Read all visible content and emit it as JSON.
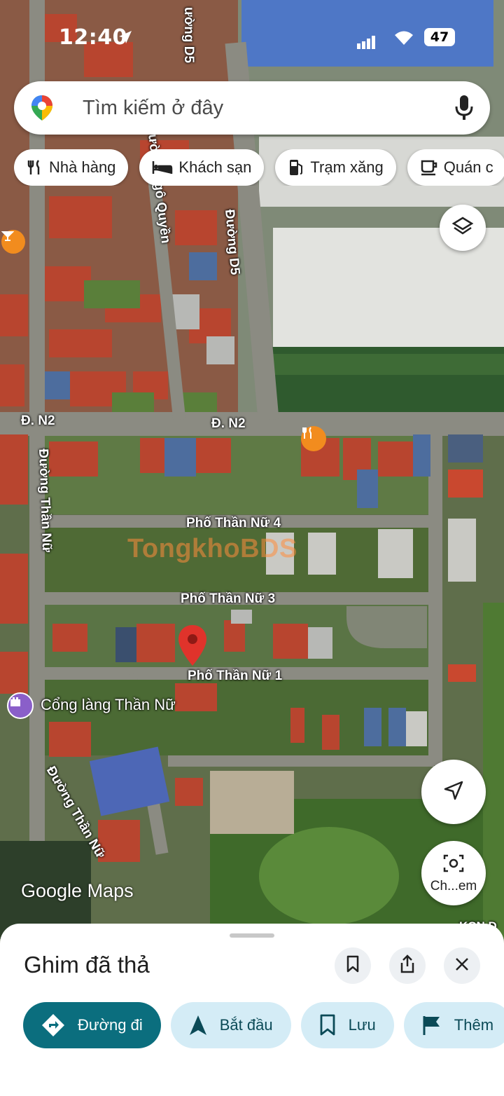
{
  "status": {
    "time": "12:40",
    "battery": "47"
  },
  "search": {
    "placeholder": "Tìm kiếm ở đây"
  },
  "chips": [
    {
      "label": "Nhà hàng",
      "icon": "fork-knife-icon"
    },
    {
      "label": "Khách sạn",
      "icon": "bed-icon"
    },
    {
      "label": "Trạm xăng",
      "icon": "gas-pump-icon"
    },
    {
      "label": "Quán c",
      "icon": "coffee-cup-icon"
    }
  ],
  "map": {
    "streets": {
      "d5_top": "ường D5",
      "ngo_quyen": "ường Ngô Quyền",
      "d5": "Đường D5",
      "n2_left": "Đ. N2",
      "n2_mid": "Đ. N2",
      "than_nu_left": "Đường Thần Nữ",
      "pho4": "Phố Thần Nữ 4",
      "pho3": "Phố Thần Nữ 3",
      "pho1": "Phố Thần Nữ 1",
      "than_nu_bottom": "Đường Thần Nữ",
      "kcn": "KCN Đ"
    },
    "poi": {
      "cong_lang": "Cổng làng Thần Nữ"
    },
    "watermark": "TongkhoBDS",
    "attribution": "Google Maps",
    "lens_label": "Ch...em"
  },
  "sheet": {
    "title": "Ghim đã thả",
    "actions": [
      {
        "label": "Đường đi",
        "icon": "directions-icon"
      },
      {
        "label": "Bắt đầu",
        "icon": "navigate-arrow-icon"
      },
      {
        "label": "Lưu",
        "icon": "bookmark-icon"
      },
      {
        "label": "Thêm",
        "icon": "flag-icon"
      }
    ]
  },
  "colors": {
    "accent": "#0b6e7e",
    "action_bg": "#d4ecf6",
    "pin": "#e0332b",
    "poi_orange": "#f28c1e",
    "poi_purple": "#8a5fc9"
  }
}
